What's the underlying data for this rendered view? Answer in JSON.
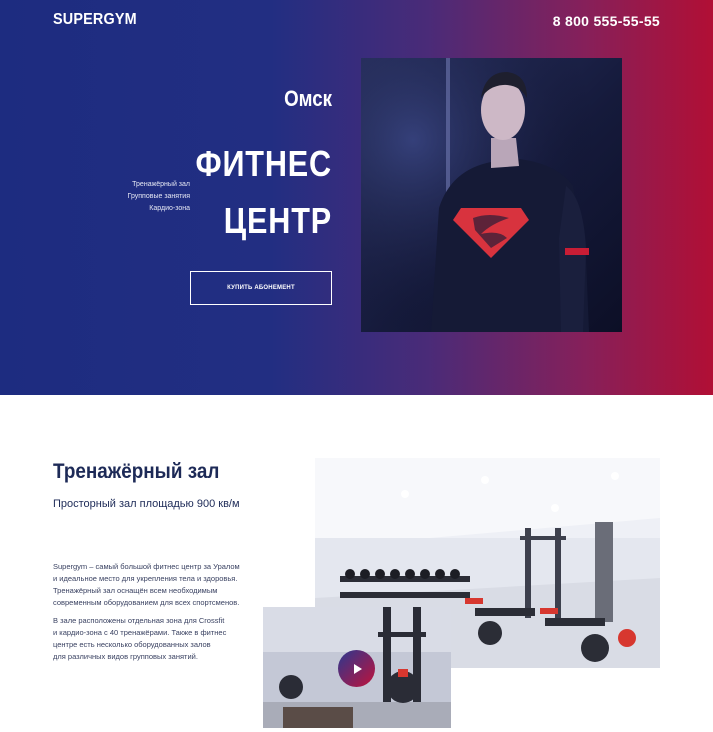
{
  "header": {
    "logo": "SUPERGYM",
    "phone": "8 800 555-55-55"
  },
  "hero": {
    "city": "Омск",
    "title_line1": "ФИТНЕС",
    "title_line2": "ЦЕНТР",
    "services": [
      "Тренажёрный зал",
      "Групповые занятия",
      "Кардио-зона"
    ],
    "buy_button": "КУПИТЬ АБОНЕМЕНТ"
  },
  "gym": {
    "heading": "Тренажёрный зал",
    "subheading": "Просторный зал площадью 900 кв/м",
    "description_p1": [
      "Supergym – самый большой фитнес центр за Уралом",
      "и идеальное место для укрепления тела и здоровья.",
      "Тренажёрный зал оснащён всем необходимым",
      "современным оборудованием для всех спортсменов."
    ],
    "description_p2": [
      "В зале расположены отдельная зона для Crossfit",
      "и кардио-зона с 40 тренажёрами. Также в фитнес",
      "центре есть несколько оборудованных залов",
      "для различных видов групповых занятий."
    ]
  },
  "icons": {
    "play": "play-icon"
  },
  "colors": {
    "gradient_start": "#1d2c80",
    "gradient_end": "#b10f35",
    "heading_text": "#1d2a57"
  }
}
